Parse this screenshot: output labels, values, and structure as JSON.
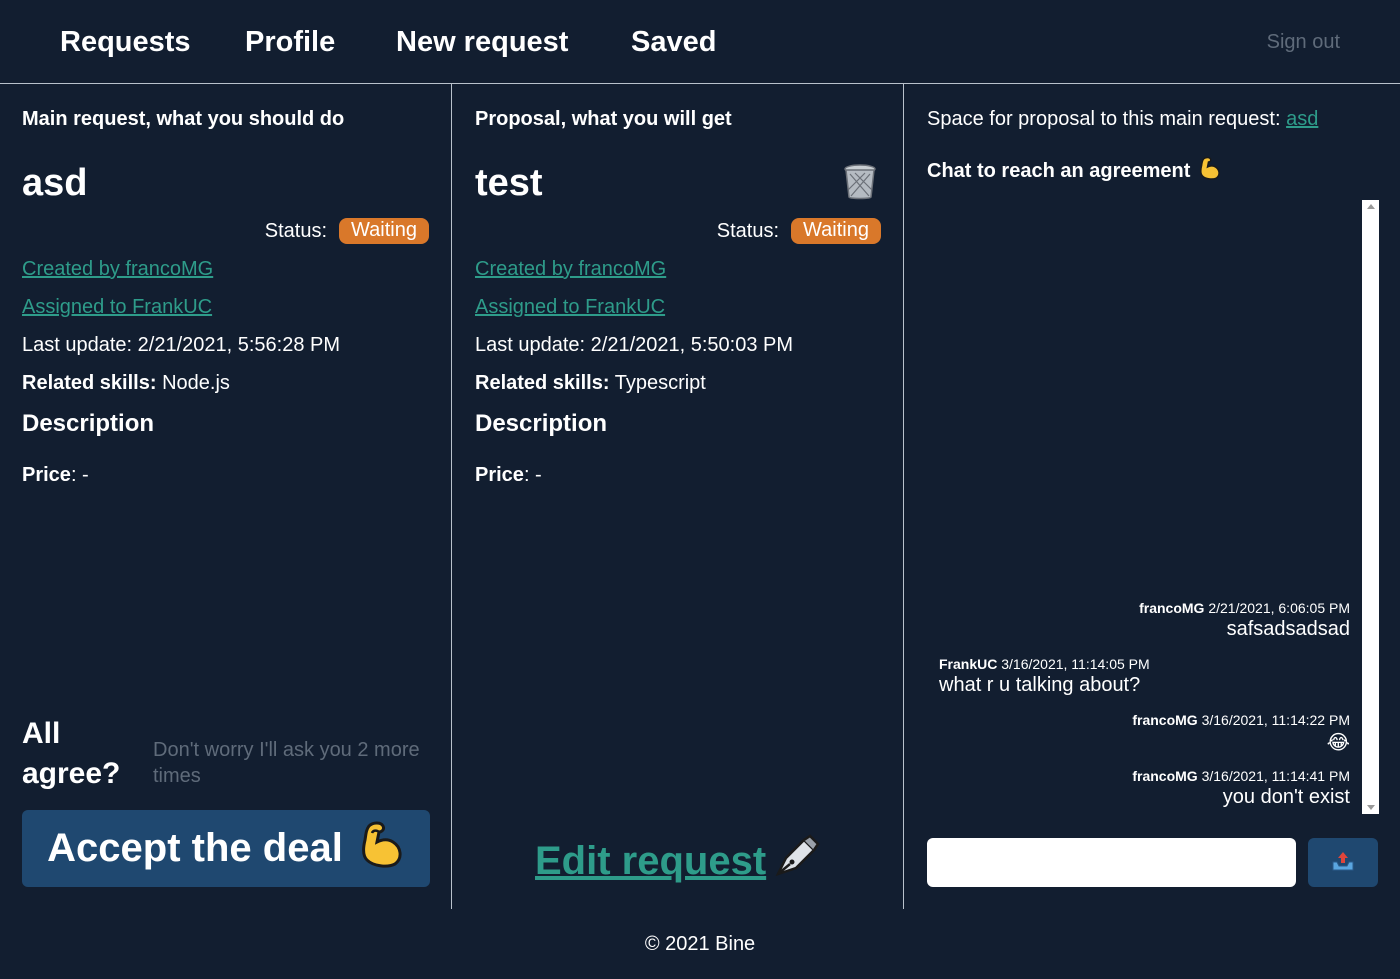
{
  "nav": {
    "items": [
      "Requests",
      "Profile",
      "New request",
      "Saved"
    ],
    "signout": "Sign out"
  },
  "main_request": {
    "heading": "Main request, what you should do",
    "title": "asd",
    "status_label": "Status:",
    "status": "Waiting",
    "created_by": "Created by francoMG",
    "assigned_to": "Assigned to FrankUC",
    "last_update": "Last update: 2/21/2021, 5:56:28 PM",
    "skills_label": "Related skills:",
    "skills": "Node.js",
    "description_heading": "Description",
    "price_label": "Price",
    "price_value": ": -",
    "agree_label": "All agree?",
    "agree_hint": "Don't worry I'll ask you 2 more times",
    "accept_button": "Accept the deal",
    "accept_icon": "flexed-biceps-icon"
  },
  "proposal": {
    "heading": "Proposal, what you will get",
    "title": "test",
    "delete_icon": "wastebasket-icon",
    "status_label": "Status:",
    "status": "Waiting",
    "created_by": "Created by francoMG",
    "assigned_to": "Assigned to FrankUC",
    "last_update": "Last update: 2/21/2021, 5:50:03 PM",
    "skills_label": "Related skills:",
    "skills": "Typescript",
    "description_heading": "Description",
    "price_label": "Price",
    "price_value": ": -",
    "edit_link": "Edit request",
    "edit_icon": "fountain-pen-icon"
  },
  "chat": {
    "proposal_line": "Space for proposal to this main request:",
    "proposal_link": "asd",
    "heading": "Chat to reach an agreement",
    "heading_icon": "flexed-biceps-icon",
    "messages": [
      {
        "author": "francoMG",
        "time": "2/21/2021, 6:06:05 PM",
        "text": "safsadsadsad",
        "align": "right"
      },
      {
        "author": "FrankUC",
        "time": "3/16/2021, 11:14:05 PM",
        "text": "what r u talking about?",
        "align": "left"
      },
      {
        "author": "francoMG",
        "time": "3/16/2021, 11:14:22 PM",
        "text": "😂",
        "align": "right"
      },
      {
        "author": "francoMG",
        "time": "3/16/2021, 11:14:41 PM",
        "text": "you don't exist",
        "align": "right"
      }
    ],
    "input_value": "",
    "send_icon": "outbox-tray-icon"
  },
  "colors": {
    "background": "#121e30",
    "accent_link": "#2e9c8a",
    "status_badge": "#d9782a",
    "button": "#1f4870"
  },
  "footer": "© 2021 Bine"
}
